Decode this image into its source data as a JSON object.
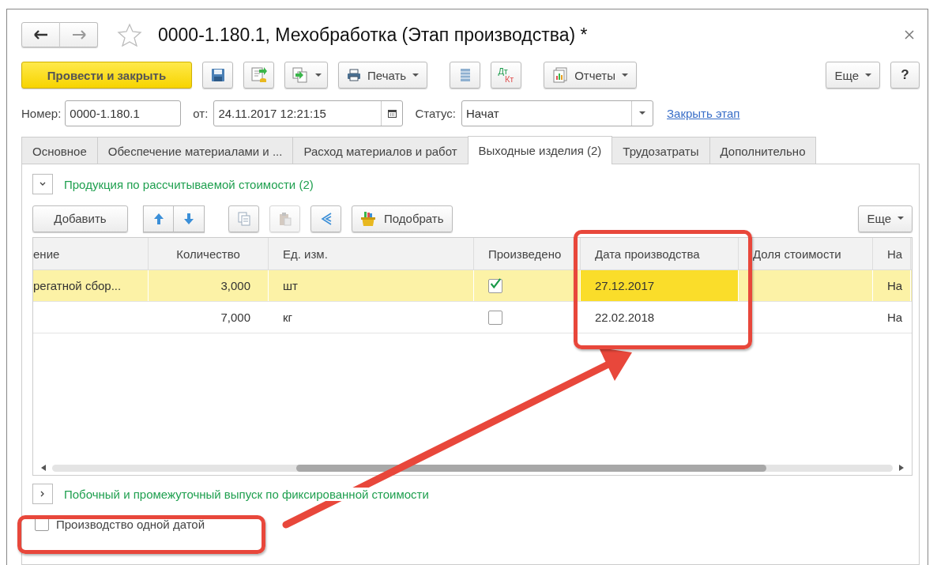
{
  "window": {
    "title": "0000-1.180.1, Мехобработка (Этап производства) *",
    "favorite": false
  },
  "toolbar": {
    "primary": "Провести и закрыть",
    "print": "Печать",
    "dt": "Дт",
    "kt": "Кт",
    "reports": "Отчеты",
    "more": "Еще",
    "help": "?"
  },
  "header": {
    "number_label": "Номер:",
    "number": "0000-1.180.1",
    "date_label": "от:",
    "date": "24.11.2017 12:21:15",
    "status_label": "Статус:",
    "status": "Начат",
    "link": "Закрыть этап"
  },
  "tabs": [
    {
      "label": "Основное",
      "selected": false
    },
    {
      "label": "Обеспечение материалами и ...",
      "selected": false
    },
    {
      "label": "Расход материалов и работ",
      "selected": false
    },
    {
      "label": "Выходные изделия (2)",
      "selected": true
    },
    {
      "label": "Трудозатраты",
      "selected": false
    },
    {
      "label": "Дополнительно",
      "selected": false
    }
  ],
  "section_main": {
    "title": "Продукция по рассчитываемой стоимости (2)",
    "expanded": true
  },
  "table_toolbar": {
    "add": "Добавить",
    "pick": "Подобрать",
    "more": "Еще"
  },
  "table": {
    "columns": [
      "ение",
      "Количество",
      "Ед. изм.",
      "Произведено",
      "Дата производства",
      "Доля стоимости",
      "На"
    ],
    "rows": [
      {
        "selected": true,
        "name": "регатной сбор...",
        "quantity": "3,000",
        "unit": "шт",
        "produced": true,
        "date": "27.12.2017",
        "date_focused": true,
        "column_7": "На"
      },
      {
        "selected": false,
        "quantity": "7,000",
        "unit": "кг",
        "produced": false,
        "date": "22.02.2018",
        "date_focused": false,
        "column_7": "На"
      }
    ]
  },
  "section_side": {
    "title": "Побочный и промежуточный выпуск по фиксированной стоимости",
    "expanded": false
  },
  "single_date": {
    "label": "Производство одной датой",
    "checked": false
  }
}
